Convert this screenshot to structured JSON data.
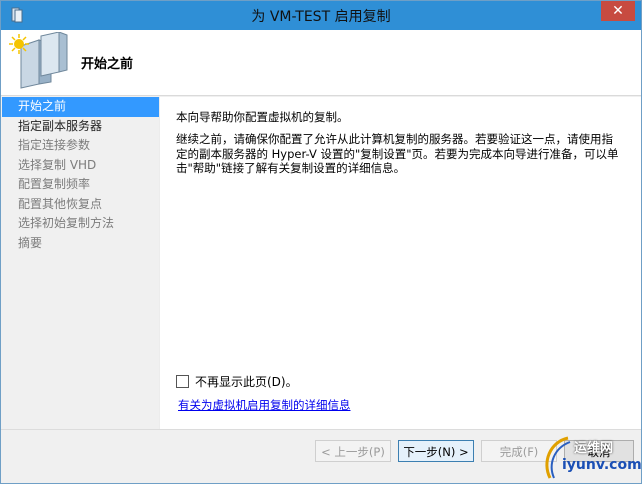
{
  "window": {
    "title": "为 VM-TEST 启用复制",
    "close": "✕"
  },
  "header": {
    "title": "开始之前"
  },
  "nav": [
    {
      "label": "开始之前",
      "state": "active"
    },
    {
      "label": "指定副本服务器",
      "state": "enabled"
    },
    {
      "label": "指定连接参数",
      "state": "disabled"
    },
    {
      "label": "选择复制 VHD",
      "state": "disabled"
    },
    {
      "label": "配置复制频率",
      "state": "disabled"
    },
    {
      "label": "配置其他恢复点",
      "state": "disabled"
    },
    {
      "label": "选择初始复制方法",
      "state": "disabled"
    },
    {
      "label": "摘要",
      "state": "disabled"
    }
  ],
  "content": {
    "intro": "本向导帮助你配置虚拟机的复制。",
    "description": "继续之前，请确保你配置了允许从此计算机复制的服务器。若要验证这一点，请使用指定的副本服务器的 Hyper-V 设置的\"复制设置\"页。若要为完成本向导进行准备，可以单击\"帮助\"链接了解有关复制设置的详细信息。",
    "dont_show_label": "不再显示此页(D)。",
    "help_link": "有关为虚拟机启用复制的详细信息"
  },
  "buttons": {
    "previous": "< 上一步(P)",
    "next": "下一步(N) >",
    "finish": "完成(F)",
    "cancel": "取消"
  },
  "watermark": {
    "top": "运维网",
    "bottom": "iyunv.com"
  },
  "colors": {
    "titlebar": "#2f8fd6",
    "selection": "#3399ff",
    "link": "#0000ee",
    "close": "#c74b40"
  }
}
